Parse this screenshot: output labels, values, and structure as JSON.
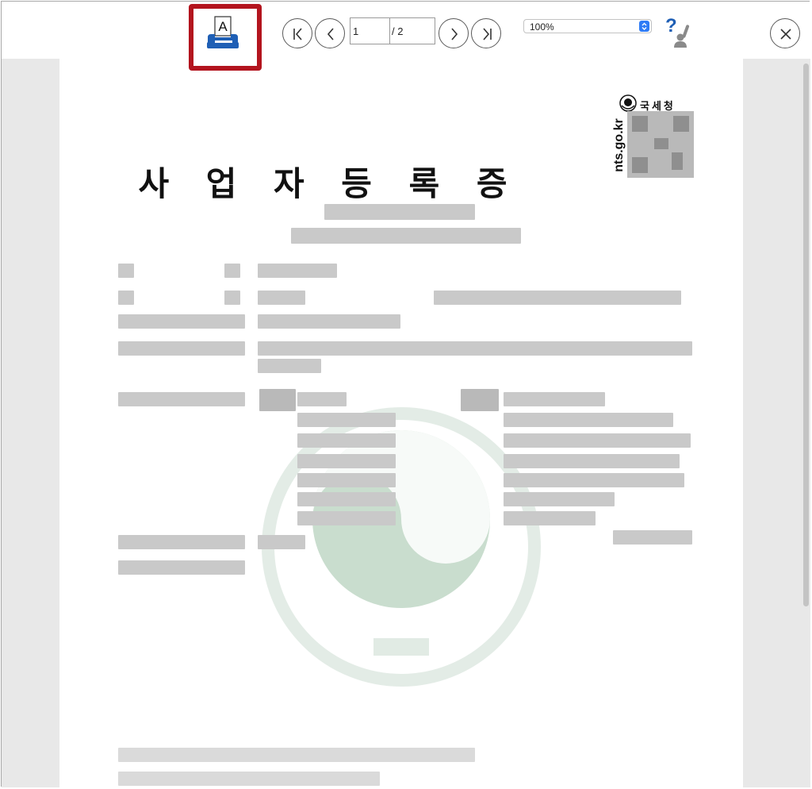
{
  "toolbar": {
    "print_icon_letter": "A",
    "page": {
      "current": "1",
      "total": "/ 2"
    },
    "zoom": {
      "value": "100%"
    },
    "help_mark": "?"
  },
  "document": {
    "title": "사 업 자 등 록 증",
    "brand": {
      "name": "국세청",
      "url": "nts.go.kr"
    }
  },
  "colors": {
    "print_highlight": "#b3141e",
    "print_icon": "#1f5fb5",
    "help_icon": "#1f5fb5",
    "zoom_arrows": "#2f7cf6",
    "seal": "#c9ddce",
    "viewer_background": "#e8e8e8"
  },
  "icons": {
    "print": "printer-icon",
    "first": "first-page-icon",
    "prev": "chevron-left-icon",
    "next": "chevron-right-icon",
    "last": "last-page-icon",
    "help": "help-icon",
    "close": "close-icon"
  }
}
